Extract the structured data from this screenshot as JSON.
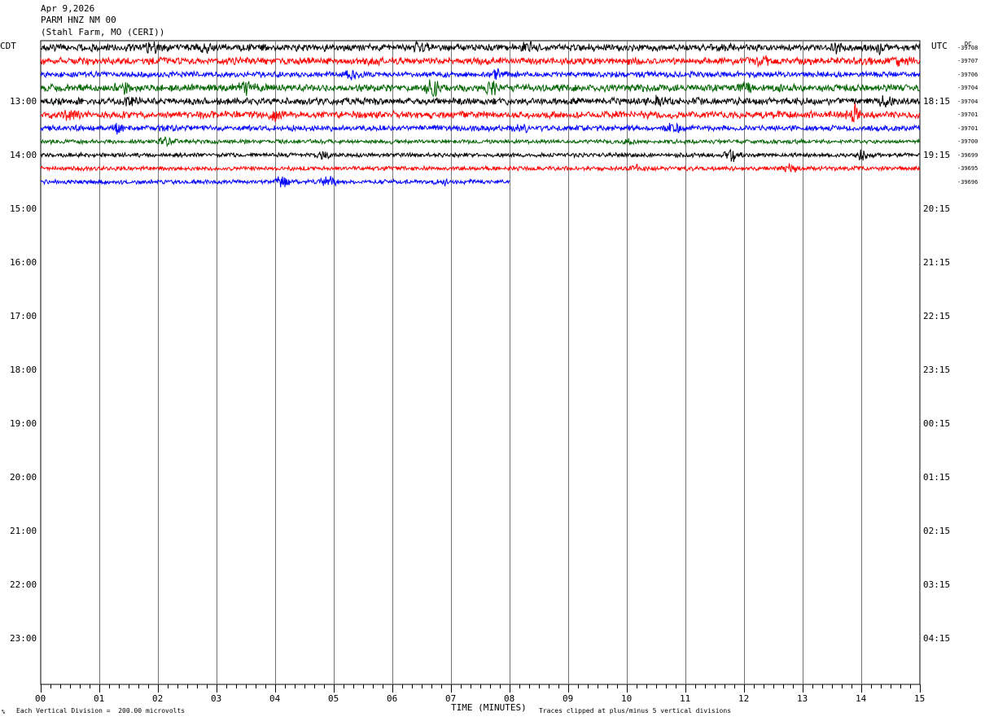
{
  "header": {
    "date": "Apr 9,2026",
    "station": "PARM HNZ NM 00",
    "location": "(Stahl Farm, MO (CERI))"
  },
  "labels": {
    "left_tz": "CDT",
    "right_tz": "UTC",
    "dc": "DC",
    "xlabel": "TIME (MINUTES)",
    "scale_note": "Each Vertical Division =  200.00 microvolts",
    "clip_note": "Traces clipped at plus/minus 5 vertical divisions",
    "corner_mark": "%"
  },
  "chart_data": {
    "type": "line",
    "title": "PARM HNZ NM 00",
    "xlabel": "TIME (MINUTES)",
    "xlim": [
      0,
      15
    ],
    "x_ticks": [
      "00",
      "01",
      "02",
      "03",
      "04",
      "05",
      "06",
      "07",
      "08",
      "09",
      "10",
      "11",
      "12",
      "13",
      "14",
      "15"
    ],
    "left_hour_labels": [
      "13:00",
      "14:00",
      "15:00",
      "16:00",
      "17:00",
      "18:00",
      "19:00",
      "20:00",
      "21:00",
      "22:00",
      "23:00"
    ],
    "right_hour_labels": [
      "18:15",
      "19:15",
      "20:15",
      "21:15",
      "22:15",
      "23:15",
      "00:15",
      "01:15",
      "02:15",
      "03:15",
      "04:15"
    ],
    "traces_per_hour": 4,
    "trace_colors": [
      "#000000",
      "#ff0000",
      "#0000ff",
      "#006400"
    ],
    "dc_offsets": [
      "-39708",
      "-39707",
      "-39706",
      "-39704",
      "-39704",
      "-39701",
      "-39701",
      "-39700",
      "-39699",
      "-39695",
      "-39696"
    ],
    "series": [
      {
        "row": 0,
        "end_min": 15,
        "amp": 5,
        "bursts": [
          [
            1.9,
            5
          ],
          [
            2.8,
            4
          ],
          [
            6.5,
            5
          ],
          [
            8.3,
            4
          ],
          [
            13.6,
            5
          ],
          [
            14.3,
            5
          ]
        ]
      },
      {
        "row": 1,
        "end_min": 15,
        "amp": 5,
        "bursts": [
          [
            5.7,
            4
          ],
          [
            12.3,
            4
          ],
          [
            14.7,
            5
          ]
        ]
      },
      {
        "row": 2,
        "end_min": 15,
        "amp": 4,
        "bursts": [
          [
            5.3,
            6
          ],
          [
            7.8,
            6
          ]
        ]
      },
      {
        "row": 3,
        "end_min": 15,
        "amp": 5,
        "bursts": [
          [
            1.4,
            6
          ],
          [
            3.5,
            7
          ],
          [
            6.7,
            12
          ],
          [
            7.7,
            7
          ],
          [
            12.0,
            6
          ]
        ]
      },
      {
        "row": 4,
        "end_min": 15,
        "amp": 5,
        "bursts": [
          [
            1.5,
            4
          ],
          [
            10.5,
            4
          ],
          [
            14.4,
            5
          ]
        ]
      },
      {
        "row": 5,
        "end_min": 15,
        "amp": 5,
        "bursts": [
          [
            0.5,
            4
          ],
          [
            4.0,
            5
          ],
          [
            13.9,
            10
          ]
        ]
      },
      {
        "row": 6,
        "end_min": 15,
        "amp": 4,
        "bursts": [
          [
            1.3,
            5
          ],
          [
            8.2,
            4
          ],
          [
            10.8,
            5
          ]
        ]
      },
      {
        "row": 7,
        "end_min": 15,
        "amp": 3,
        "bursts": [
          [
            2.1,
            5
          ],
          [
            10.0,
            3
          ]
        ]
      },
      {
        "row": 8,
        "end_min": 15,
        "amp": 3,
        "bursts": [
          [
            4.8,
            4
          ],
          [
            11.8,
            8
          ],
          [
            14.0,
            5
          ]
        ]
      },
      {
        "row": 9,
        "end_min": 15,
        "amp": 3,
        "bursts": [
          [
            10.2,
            4
          ],
          [
            12.8,
            4
          ]
        ]
      },
      {
        "row": 10,
        "end_min": 8,
        "amp": 3,
        "bursts": [
          [
            4.1,
            7
          ],
          [
            4.9,
            8
          ],
          [
            6.9,
            5
          ]
        ]
      }
    ]
  }
}
